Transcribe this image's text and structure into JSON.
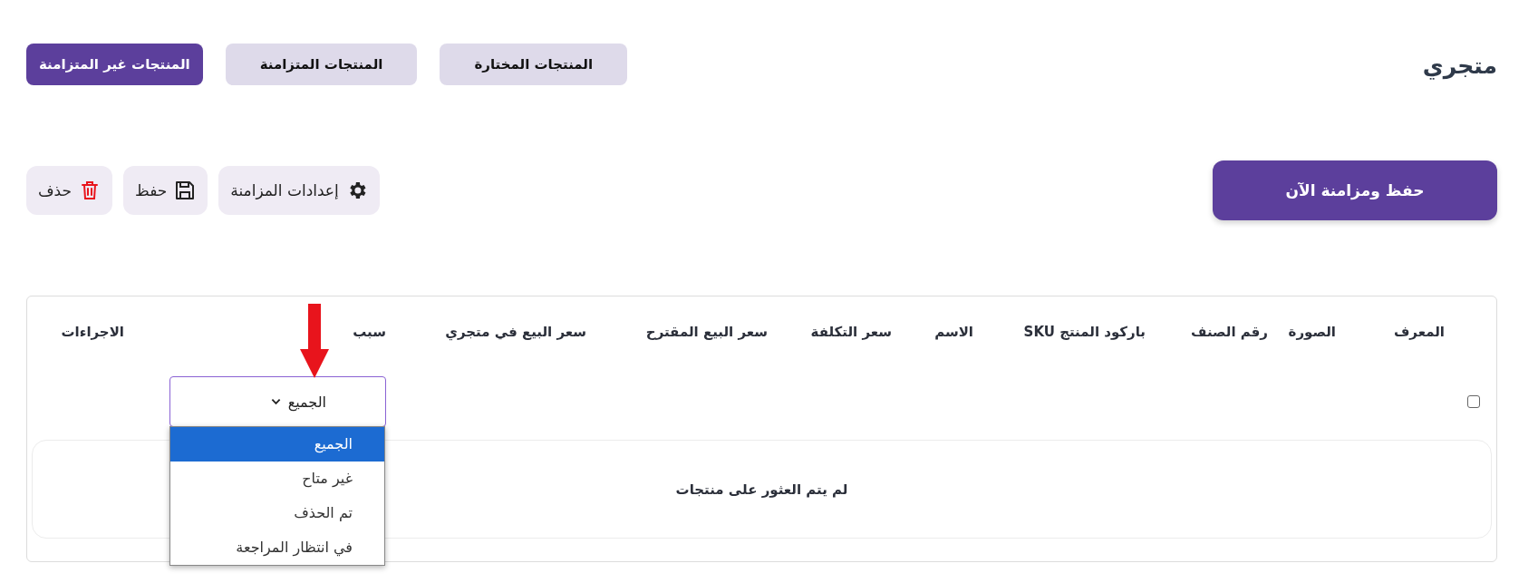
{
  "page": {
    "title": "متجري"
  },
  "tabs": [
    {
      "label": "المنتجات المختارة",
      "selected": false
    },
    {
      "label": "المنتجات المتزامنة",
      "selected": false
    },
    {
      "label": "المنتجات غير المتزامنة",
      "selected": true
    }
  ],
  "sync_button": {
    "label": "حفظ ومزامنة الآن"
  },
  "actions": [
    {
      "kind": "settings",
      "label": "إعدادات المزامنة"
    },
    {
      "kind": "save",
      "label": "حفظ"
    },
    {
      "kind": "delete",
      "label": "حذف"
    }
  ],
  "table": {
    "columns": [
      "المعرف",
      "الصورة",
      "رقم الصنف",
      "باركود المنتج SKU",
      "الاسم",
      "سعر التكلفة",
      "سعر البيع المقترح",
      "سعر البيع في متجري",
      "سبب",
      "الاجراءات"
    ],
    "select_all": {
      "checked": false
    },
    "reason_filter": {
      "value": "الجميع",
      "expanded": true,
      "options": [
        {
          "label": "الجميع",
          "selected": true
        },
        {
          "label": "غير متاح",
          "selected": false
        },
        {
          "label": "تم الحذف",
          "selected": false
        },
        {
          "label": "في انتظار المراجعة",
          "selected": false
        }
      ]
    },
    "empty_message": "لم يتم العثور على منتجات"
  }
}
